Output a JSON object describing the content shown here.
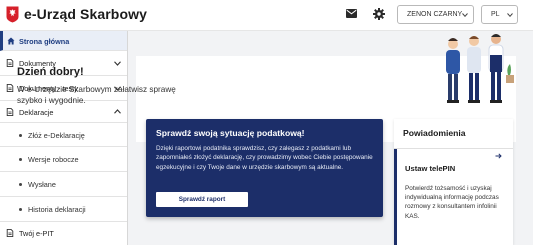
{
  "header": {
    "brand": "e-Urząd Skarbowy",
    "user_label": "ZENON CZARNY",
    "lang_label": "PL",
    "icons": {
      "mail": "mail-icon",
      "settings": "gear-icon",
      "logo": "poland-eagle-logo"
    }
  },
  "sidebar": {
    "items": [
      {
        "label": "Strona główna",
        "active": true,
        "icon": "home-icon"
      },
      {
        "label": "Dokumenty",
        "icon": "document-icon",
        "chevron": "chevron-down-icon"
      },
      {
        "label": "Dokumenty - testy",
        "icon": "document-icon",
        "chevron": "chevron-down-icon"
      },
      {
        "label": "Deklaracje",
        "icon": "document-icon",
        "chevron": "chevron-up-icon"
      },
      {
        "label": "Złóż e-Deklarację",
        "sub": true
      },
      {
        "label": "Wersje robocze",
        "sub": true
      },
      {
        "label": "Wysłane",
        "sub": true
      },
      {
        "label": "Historia deklaracji",
        "sub": true
      },
      {
        "label": "Twój e-PIT",
        "icon": "document-icon"
      }
    ]
  },
  "main": {
    "greeting": "Dzień dobry!",
    "intro": "W e-Urzędzie Skarbowym załatwisz sprawę szybko i wygodnie.",
    "tax_card": {
      "title": "Sprawdź swoją sytuację podatkową!",
      "text": "Dzięki raportowi podatnika sprawdzisz, czy zalegasz z podatkami lub zapomniałeś złożyć deklarację, czy prowadzimy wobec Ciebie postępowanie egzekucyjne i czy Twoje dane w urzędzie skarbowym są aktualne.",
      "button": "Sprawdź raport"
    },
    "notifications": {
      "heading": "Powiadomienia",
      "item_title": "Ustaw telePIN",
      "item_text": "Potwierdź tożsamość i uzyskaj indywidualną informację podczas rozmowy z konsultantem infolinii KAS."
    }
  }
}
